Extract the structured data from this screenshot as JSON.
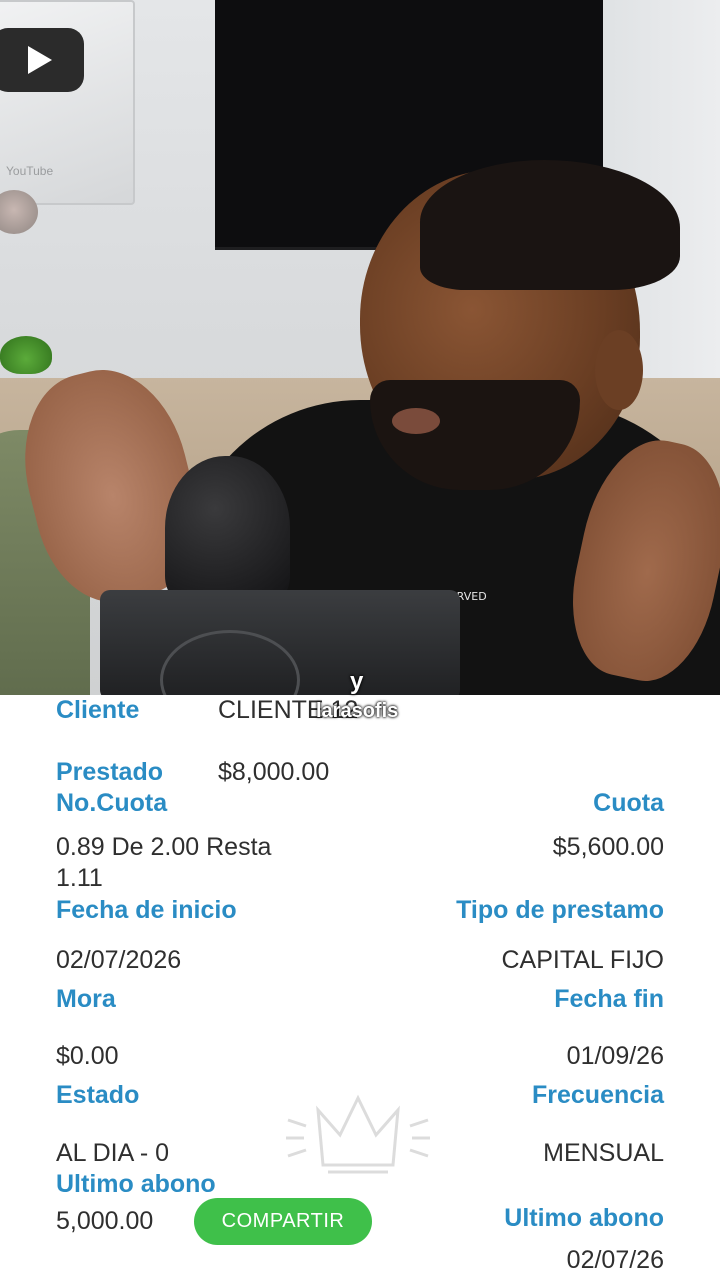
{
  "video": {
    "youtube_small_text": "YouTube",
    "shirt_print": "ALL RIGHTS RESERVED",
    "watermark_handle": "larasofis",
    "watermark_letter": "y"
  },
  "loan": {
    "cliente_label": "Cliente",
    "cliente_value": "CLIENTE 12",
    "prestado_label": "Prestado",
    "prestado_value": "$8,000.00",
    "no_cuota_label": "No.Cuota",
    "no_cuota_value_line1": "0.89 De 2.00 Resta",
    "no_cuota_value_line2": "1.11",
    "cuota_label": "Cuota",
    "cuota_value": "$5,600.00",
    "fecha_inicio_label": "Fecha de inicio",
    "fecha_inicio_value": "02/07/2026",
    "tipo_prestamo_label": "Tipo de prestamo",
    "tipo_prestamo_value": "CAPITAL FIJO",
    "mora_label": "Mora",
    "mora_value": "$0.00",
    "fecha_fin_label": "Fecha fin",
    "fecha_fin_value": "01/09/26",
    "estado_label": "Estado",
    "estado_value": "AL DIA - 0",
    "frecuencia_label": "Frecuencia",
    "frecuencia_value": "MENSUAL",
    "ultimo_abono_left_label": "Ultimo abono",
    "ultimo_abono_left_value": "5,000.00",
    "ultimo_abono_right_label": "Ultimo abono",
    "ultimo_abono_right_value": "02/07/26",
    "share_button_label": "COMPARTIR"
  },
  "colors": {
    "label_blue": "#2a8cc4",
    "value_text": "#2f2f2f",
    "share_green": "#3fc04a"
  }
}
